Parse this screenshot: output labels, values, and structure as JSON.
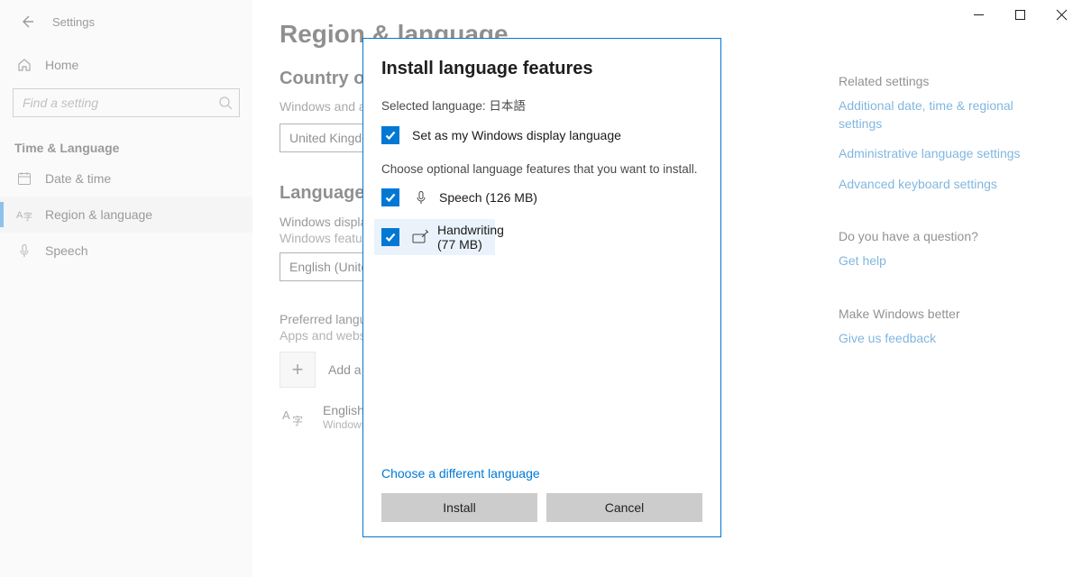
{
  "window": {
    "title": "Settings"
  },
  "nav": {
    "home": "Home",
    "search_placeholder": "Find a setting",
    "category": "Time & Language",
    "items": [
      {
        "label": "Date & time"
      },
      {
        "label": "Region & language"
      },
      {
        "label": "Speech"
      }
    ]
  },
  "page": {
    "title": "Region & language",
    "country_section": {
      "heading": "Country or region",
      "desc": "Windows and apps might use your country or region to give you local content",
      "value": "United Kingdom"
    },
    "languages_section": {
      "heading": "Languages",
      "display_label": "Windows display language",
      "display_desc": "Windows features like Settings and File Explorer will appear in this language.",
      "display_value": "English (United Kingdom)",
      "preferred_label": "Preferred languages",
      "preferred_desc": "Apps and websites will appear in the first language in the list that they support.",
      "add_label": "Add a language",
      "entry_name": "English (United Kingdom)",
      "entry_sub": "Windows display language"
    }
  },
  "right": {
    "related_heading": "Related settings",
    "link1": "Additional date, time & regional settings",
    "link2": "Administrative language settings",
    "link3": "Advanced keyboard settings",
    "question_heading": "Do you have a question?",
    "help_link": "Get help",
    "better_heading": "Make Windows better",
    "feedback_link": "Give us feedback"
  },
  "dialog": {
    "title": "Install language features",
    "selected_prefix": "Selected language: ",
    "selected_lang": "日本語",
    "set_display": "Set as my Windows display language",
    "choose_text": "Choose optional language features that you want to install.",
    "feat_speech": "Speech (126 MB)",
    "feat_handwriting": "Handwriting (77 MB)",
    "different": "Choose a different language",
    "install": "Install",
    "cancel": "Cancel"
  }
}
